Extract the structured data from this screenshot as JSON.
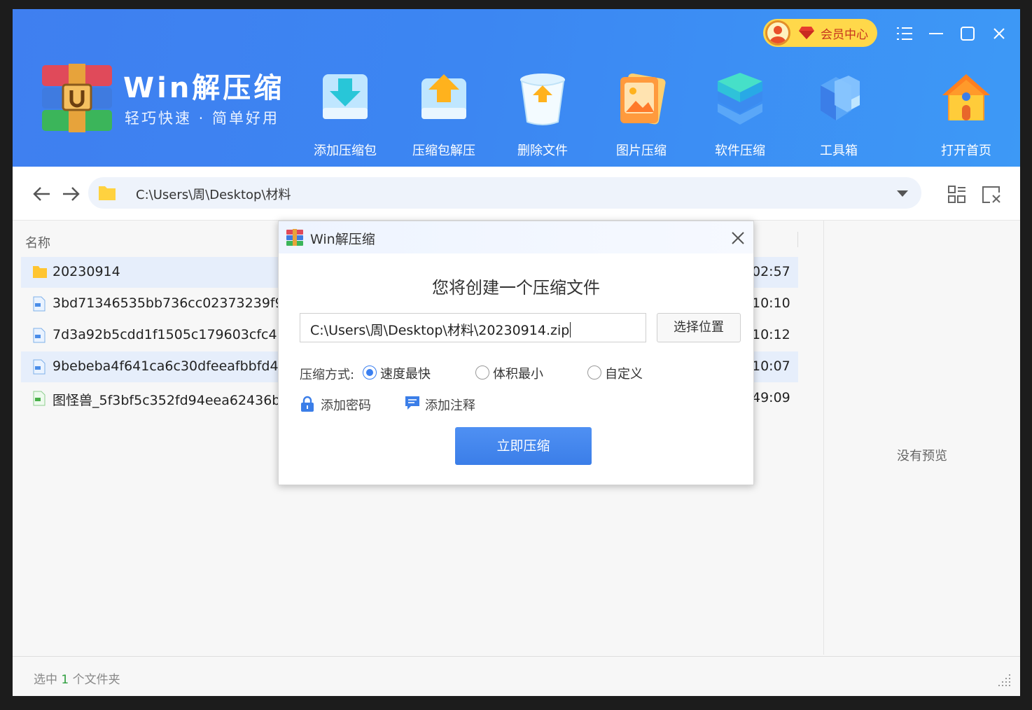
{
  "app": {
    "title": "Win解压缩",
    "subtitle": "轻巧快速 · 简单好用"
  },
  "header": {
    "vip_label": "会员中心",
    "tools": [
      {
        "label": "添加压缩包",
        "icon": "add-archive-icon"
      },
      {
        "label": "压缩包解压",
        "icon": "extract-archive-icon"
      },
      {
        "label": "删除文件",
        "icon": "delete-file-icon"
      },
      {
        "label": "图片压缩",
        "icon": "image-compress-icon"
      },
      {
        "label": "软件压缩",
        "icon": "software-compress-icon"
      },
      {
        "label": "工具箱",
        "icon": "toolbox-icon"
      },
      {
        "label": "打开首页",
        "icon": "home-icon"
      }
    ]
  },
  "addressbar": {
    "path": "C:\\Users\\周\\Desktop\\材料"
  },
  "filelist": {
    "column_name": "名称",
    "rows": [
      {
        "name": "20230914",
        "time": "02:57",
        "type": "folder",
        "selected": true
      },
      {
        "name": "3bd71346535bb736cc02373239f9be",
        "time": "10:10",
        "type": "jpg",
        "selected": false
      },
      {
        "name": "7d3a92b5cdd1f1505c179603cfc4722",
        "time": "10:12",
        "type": "jpg",
        "selected": false
      },
      {
        "name": "9bebeba4f641ca6c30dfeeafbbfd48b.",
        "time": "10:07",
        "type": "jpg",
        "selected": true
      },
      {
        "name": "图怪兽_5f3bf5c352fd94eea62436b70",
        "time": "49:09",
        "type": "png",
        "selected": false
      }
    ]
  },
  "preview": {
    "empty_text": "没有预览"
  },
  "status": {
    "prefix": "选中",
    "count": "1",
    "suffix": "个文件夹"
  },
  "dialog": {
    "title": "Win解压缩",
    "message": "您将创建一个压缩文件",
    "path_value": "C:\\Users\\周\\Desktop\\材料\\20230914.zip",
    "choose_location": "选择位置",
    "mode_label": "压缩方式:",
    "modes": [
      {
        "label": "速度最快",
        "checked": true
      },
      {
        "label": "体积最小",
        "checked": false
      },
      {
        "label": "自定义",
        "checked": false
      }
    ],
    "add_password": "添加密码",
    "add_comment": "添加注释",
    "compress_now": "立即压缩"
  },
  "colors": {
    "header_start": "#3f7ff0",
    "header_end": "#3d99f6",
    "accent": "#3a7ff0",
    "vip_bg": "#ffd84a",
    "status_count": "#2e9e3e"
  }
}
